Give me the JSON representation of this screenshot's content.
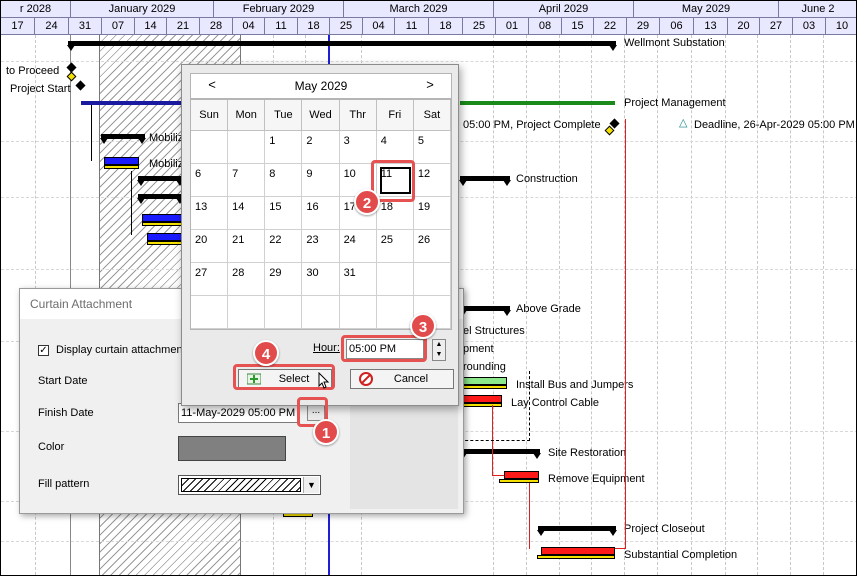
{
  "timescale": {
    "months": [
      "r 2028",
      "January 2029",
      "February 2029",
      "March 2029",
      "April 2029",
      "May 2029",
      "June 2"
    ],
    "days": [
      "17",
      "24",
      "31",
      "07",
      "14",
      "21",
      "28",
      "04",
      "11",
      "18",
      "25",
      "04",
      "11",
      "18",
      "25",
      "01",
      "08",
      "15",
      "22",
      "29",
      "06",
      "13",
      "20",
      "27",
      "03",
      "10"
    ]
  },
  "gantt": {
    "labels": {
      "wellmont": "Wellmont Substation",
      "ntp": "to Proceed",
      "project_start": "Project Start",
      "project_mgmt": "Project Management",
      "project_complete": "05:00 PM, Project Complete",
      "deadline": "Deadline, 26-Apr-2029 05:00 PM",
      "mobiliz1": "Mobiliz",
      "mobiliz2": "Mobiliz",
      "construction": "Construction",
      "above_grade": "Above Grade",
      "steel": "el Structures",
      "equipment": "pment",
      "grounding": "rounding",
      "bus": "Install Bus and Jumpers",
      "control": "Lay Control Cable",
      "site_restoration": "Site Restoration",
      "remove_equipment": "Remove Equipment",
      "closeout": "Project Closeout",
      "substantial": "Substantial Completion"
    }
  },
  "curtain_dialog": {
    "title": "Curtain Attachment",
    "display_label": "Display curtain attachment",
    "display_checked": "✓",
    "start_label": "Start Date",
    "finish_label": "Finish Date",
    "finish_value": "11-May-2029 05:00 PM",
    "ellipsis": "...",
    "color_label": "Color",
    "color_value": "#808080",
    "fill_label": "Fill pattern"
  },
  "date_picker": {
    "month": "May 2029",
    "prev": "<",
    "next": ">",
    "weekdays": [
      "Sun",
      "Mon",
      "Tue",
      "Wed",
      "Thr",
      "Fri",
      "Sat"
    ],
    "weeks": [
      [
        "",
        "",
        "1",
        "2",
        "3",
        "4",
        "5"
      ],
      [
        "6",
        "7",
        "8",
        "9",
        "10",
        "11",
        "12"
      ],
      [
        "13",
        "14",
        "15",
        "16",
        "17",
        "18",
        "19"
      ],
      [
        "20",
        "21",
        "22",
        "23",
        "24",
        "25",
        "26"
      ],
      [
        "27",
        "28",
        "29",
        "30",
        "31",
        "",
        ""
      ],
      [
        "",
        "",
        "",
        "",
        "",
        "",
        ""
      ]
    ],
    "selected_day": "11",
    "hour_label": "Hour:",
    "hour_value": "05:00 PM",
    "select_label": "Select",
    "cancel_label": "Cancel"
  },
  "callouts": [
    "1",
    "2",
    "3",
    "4"
  ],
  "colors": {
    "highlight": "#e65252",
    "task_blue": "#1a1aff",
    "task_green": "#8be88b",
    "task_red": "#ff1a1a",
    "summary_green": "#1a8a1a"
  }
}
